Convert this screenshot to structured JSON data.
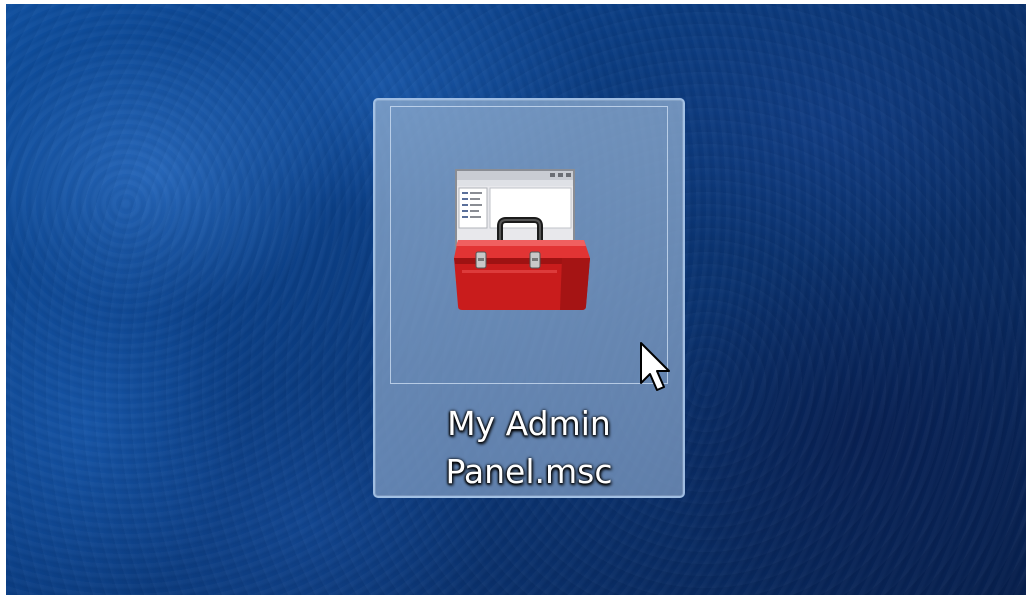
{
  "desktop": {
    "wallpaper": "blue-textured",
    "colors": {
      "wallpaper_light": "#1a5fb0",
      "wallpaper_dark": "#071f4d",
      "selection_fill": "#8aa8cc",
      "selection_border": "#aac8eb",
      "toolbox_red": "#d21e1e"
    },
    "icons": [
      {
        "icon": "toolbox-window-icon",
        "label_line1": "My Admin",
        "label_line2": "Panel.msc",
        "selected": true
      }
    ]
  },
  "cursor": {
    "type": "arrow-cursor"
  }
}
